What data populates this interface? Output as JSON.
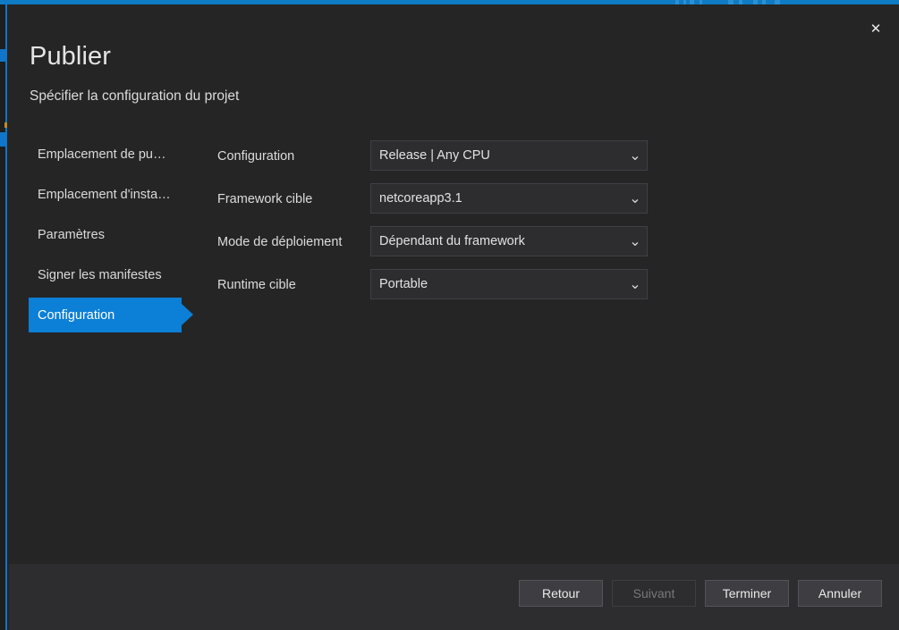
{
  "window": {
    "close_label": "✕",
    "accent_color": "#0c7fd6",
    "body_color": "#252526",
    "footer_color": "#2d2d30"
  },
  "header": {
    "title": "Publier",
    "subtitle": "Spécifier la configuration du projet"
  },
  "sidebar": {
    "items": [
      {
        "label": "Emplacement de pu…",
        "selected": false
      },
      {
        "label": "Emplacement d'insta…",
        "selected": false
      },
      {
        "label": "Paramètres",
        "selected": false
      },
      {
        "label": "Signer les manifestes",
        "selected": false
      },
      {
        "label": "Configuration",
        "selected": true
      }
    ]
  },
  "form": {
    "rows": [
      {
        "label": "Configuration",
        "value": "Release | Any CPU",
        "icon": "chevron-down-icon",
        "glyph": "⌄"
      },
      {
        "label": "Framework cible",
        "value": "netcoreapp3.1",
        "icon": "chevron-down-icon",
        "glyph": "⌄"
      },
      {
        "label": "Mode de déploiement",
        "value": "Dépendant du framework",
        "icon": "chevron-down-icon",
        "glyph": "⌄"
      },
      {
        "label": "Runtime cible",
        "value": "Portable",
        "icon": "chevron-down-icon",
        "glyph": "⌄"
      }
    ]
  },
  "footer": {
    "buttons": [
      {
        "label": "Retour",
        "disabled": false
      },
      {
        "label": "Suivant",
        "disabled": true
      },
      {
        "label": "Terminer",
        "disabled": false
      },
      {
        "label": "Annuler",
        "disabled": false
      }
    ]
  }
}
